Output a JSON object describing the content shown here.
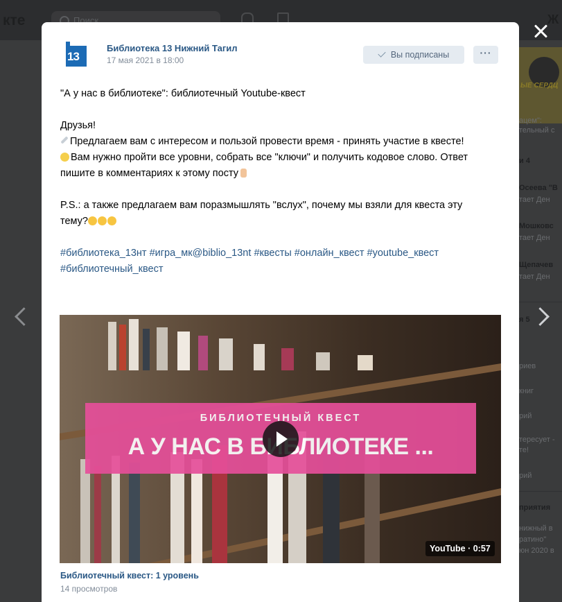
{
  "background": {
    "logo_text": "кте",
    "search_placeholder": "Поиск",
    "user_initial": "Ж",
    "right_column": {
      "banner_text": "ЫЕ СЕРДЦ",
      "items": [
        "ацем\":",
        "тельный с",
        "и 4",
        "Осеева \"В",
        "тает Ден",
        "Мошковс",
        "тает Ден",
        "Щепачев",
        "тает Ден",
        "я 5",
        "риев",
        "книг",
        "рий",
        "тересует -",
        "те!",
        "рий",
        "приятия",
        "нижный в",
        "ратино\"",
        "юн 2020 в"
      ]
    }
  },
  "post": {
    "author": "Библиотека 13 Нижний Тагил",
    "avatar_text": "13",
    "date": "17 мая 2021 в 18:00",
    "subscribed_label": "Вы подписаны",
    "more_label": "···",
    "title": "\"А у нас в библиотеке\": библиотечный Youtube-квест",
    "greeting": "Друзья!",
    "line1": "Предлагаем вам с интересом и пользой провести время - принять участие в квесте!",
    "line2": "Вам нужно пройти все уровни, собрать все \"ключи\" и получить кодовое слово. Ответ пишите в комментариях к этому посту",
    "ps": "P.S.: а также предлагаем вам поразмышлять \"вслух\", почему мы взяли для квеста эту тему?",
    "hashtags": [
      "#библиотека_13нт",
      "#игра_мк@biblio_13nt",
      "#квесты",
      "#онлайн_квест",
      "#youtube_квест",
      "#библиотечный_квест"
    ]
  },
  "video": {
    "banner_subtitle": "БИБЛИОТЕЧНЫЙ КВЕСТ",
    "banner_title": "А У НАС В БИБЛИОТЕКЕ ...",
    "duration_label": "YouTube · 0:57",
    "title": "Библиотечный квест: 1 уровень",
    "views": "14 просмотров"
  },
  "icons": {
    "close": "close-icon",
    "prev": "chevron-left-icon",
    "next": "chevron-right-icon",
    "play": "play-icon",
    "check": "check-icon"
  },
  "colors": {
    "link": "#2a5885",
    "button_bg": "#e5ebf1",
    "banner_pink": "#e64f9a",
    "overlay": "#3a3b3c"
  }
}
